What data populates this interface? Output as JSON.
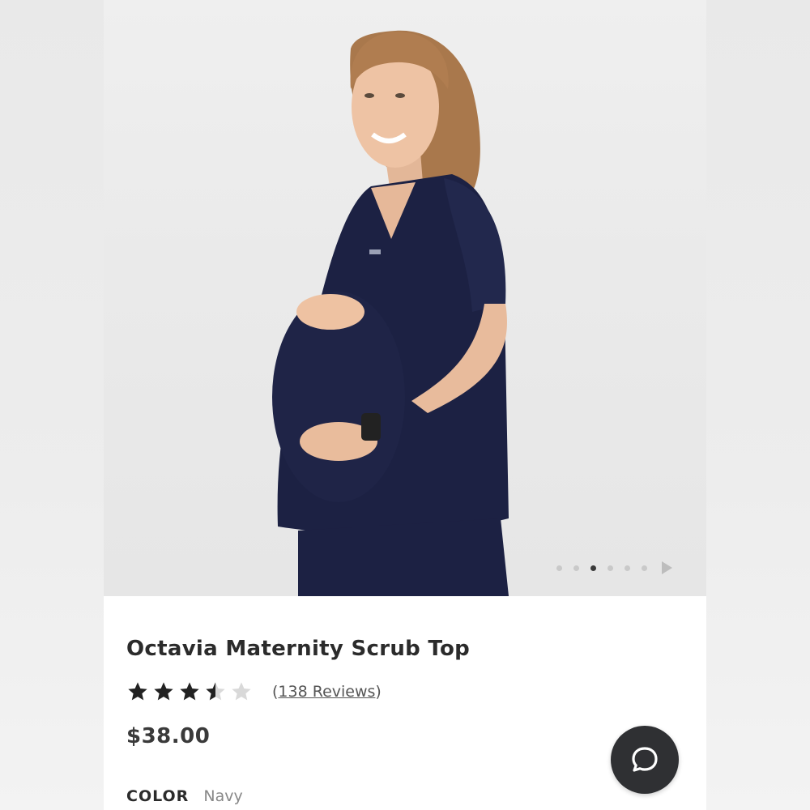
{
  "product": {
    "title": "Octavia Maternity Scrub Top",
    "rating": 3.5,
    "rating_max": 5,
    "reviews_open": "(",
    "reviews_text": "138 Reviews",
    "reviews_close": ")",
    "price": "$38.00",
    "color_label": "COLOR",
    "color_value": "Navy"
  },
  "gallery": {
    "total_images": 6,
    "active_index": 2,
    "next_icon": "play-triangle-icon"
  },
  "colors": {
    "scrub": "#1c2143",
    "accent": "#2f3033",
    "star": "#222222",
    "star_empty": "#d9d9d9"
  },
  "chat": {
    "icon": "chat-bubble-icon"
  }
}
